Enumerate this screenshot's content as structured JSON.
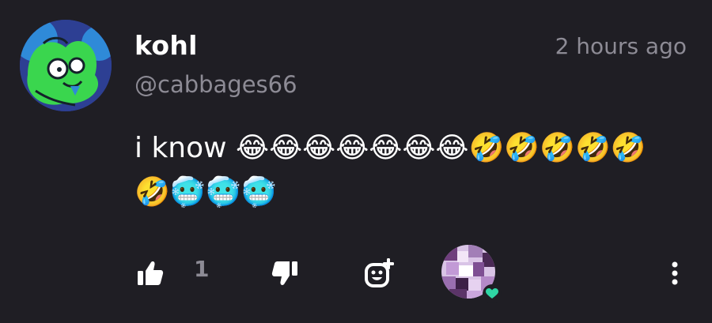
{
  "comment": {
    "author_name": "kohl",
    "author_handle": "@cabbages66",
    "timestamp": "2 hours ago",
    "text": "i know 😂😂😂😂😂😂😂🤣🤣🤣🤣🤣🤣🥶🥶🥶",
    "like_count": "1"
  },
  "icons": {
    "like": "thumbs-up-icon",
    "dislike": "thumbs-down-icon",
    "react": "add-reaction-icon",
    "heart": "heart-icon",
    "more": "more-vertical-icon"
  },
  "colors": {
    "background": "#1f1e24",
    "muted_text": "#8d8b95",
    "heart": "#2fd6a4"
  }
}
